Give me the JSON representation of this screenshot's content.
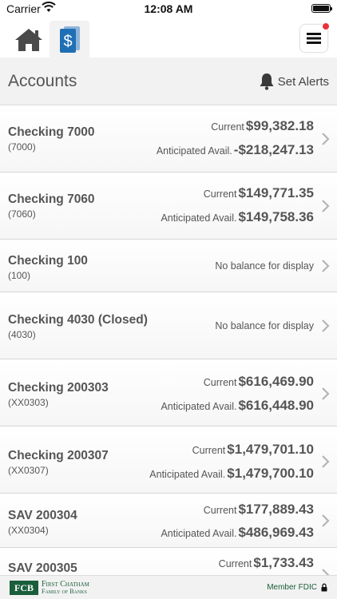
{
  "status_bar": {
    "carrier": "Carrier",
    "time": "12:08 AM"
  },
  "nav": {
    "accent_color": "#1f6fb5",
    "notification_color": "#e8333b"
  },
  "header": {
    "title": "Accounts",
    "alerts_label": "Set Alerts"
  },
  "accounts": [
    {
      "name": "Checking 7000",
      "number": "(7000)",
      "current_label": "Current",
      "current": "$99,382.18",
      "anticipated_label": "Anticipated Avail.",
      "anticipated": "-$218,247.13"
    },
    {
      "name": "Checking 7060",
      "number": "(7060)",
      "current_label": "Current",
      "current": "$149,771.35",
      "anticipated_label": "Anticipated Avail.",
      "anticipated": "$149,758.36"
    },
    {
      "name": "Checking 100",
      "number": "(100)",
      "no_balance": "No balance for display"
    },
    {
      "name": "Checking 4030 (Closed)",
      "number": "(4030)",
      "no_balance": "No balance for display"
    },
    {
      "name": "Checking 200303",
      "number": "(XX0303)",
      "current_label": "Current",
      "current": "$616,469.90",
      "anticipated_label": "Anticipated Avail.",
      "anticipated": "$616,448.90"
    },
    {
      "name": "Checking 200307",
      "number": "(XX0307)",
      "current_label": "Current",
      "current": "$1,479,701.10",
      "anticipated_label": "Anticipated Avail.",
      "anticipated": "$1,479,700.10"
    },
    {
      "name": "SAV 200304",
      "number": "(XX0304)",
      "current_label": "Current",
      "current": "$177,889.43",
      "anticipated_label": "Anticipated Avail.",
      "anticipated": "$486,969.43"
    },
    {
      "name": "SAV 200305",
      "number": "",
      "current_label": "Current",
      "current": "$1,733.43"
    }
  ],
  "footer": {
    "logo_mark": "FCB",
    "logo_line1": "First Chatham",
    "logo_line2": "Family of Banks",
    "fdic": "Member FDIC",
    "brand_color": "#1a5e3a"
  }
}
